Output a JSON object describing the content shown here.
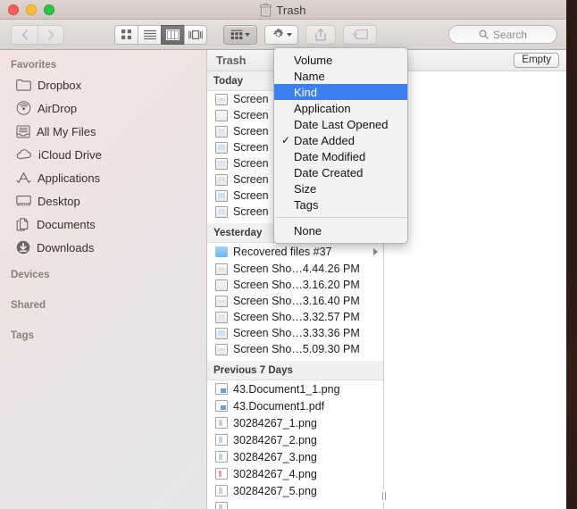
{
  "window": {
    "title": "Trash",
    "title_icon": "trash-icon",
    "traffic_lights": [
      "close",
      "minimize",
      "zoom"
    ]
  },
  "toolbar": {
    "back_icon": "chevron-left-icon",
    "forward_icon": "chevron-right-icon",
    "views": [
      {
        "name": "icon-view",
        "icon": "grid-icon",
        "active": false
      },
      {
        "name": "list-view",
        "icon": "list-icon",
        "active": false
      },
      {
        "name": "column-view",
        "icon": "columns-icon",
        "active": true
      },
      {
        "name": "coverflow-view",
        "icon": "coverflow-icon",
        "active": false
      }
    ],
    "arrange_icon": "arrange-grid-icon",
    "gear_icon": "gear-icon",
    "share_icon": "share-icon",
    "tag_icon": "tag-icon"
  },
  "search": {
    "placeholder": "Search",
    "value": "",
    "icon": "search-icon"
  },
  "sidebar": {
    "sections": [
      {
        "header": "Favorites",
        "items": [
          {
            "label": "Dropbox",
            "icon": "folder-icon"
          },
          {
            "label": "AirDrop",
            "icon": "airdrop-icon"
          },
          {
            "label": "All My Files",
            "icon": "all-my-files-icon"
          },
          {
            "label": "iCloud Drive",
            "icon": "cloud-icon"
          },
          {
            "label": "Applications",
            "icon": "applications-icon"
          },
          {
            "label": "Desktop",
            "icon": "desktop-icon"
          },
          {
            "label": "Documents",
            "icon": "documents-icon"
          },
          {
            "label": "Downloads",
            "icon": "downloads-icon"
          }
        ]
      },
      {
        "header": "Devices",
        "items": []
      },
      {
        "header": "Shared",
        "items": []
      },
      {
        "header": "Tags",
        "items": []
      }
    ]
  },
  "column1": {
    "header": "Trash",
    "groups": [
      {
        "label": "Today",
        "rows": [
          {
            "name": "Screen",
            "icon": "screenshot-icon",
            "variant": "v1"
          },
          {
            "name": "Screen",
            "icon": "screenshot-icon",
            "variant": "v2"
          },
          {
            "name": "Screen",
            "icon": "screenshot-icon",
            "variant": "v3"
          },
          {
            "name": "Screen",
            "icon": "screenshot-icon",
            "variant": "v4"
          },
          {
            "name": "Screen",
            "icon": "screenshot-icon",
            "variant": "v5"
          },
          {
            "name": "Screen",
            "icon": "screenshot-icon",
            "variant": "v3"
          },
          {
            "name": "Screen",
            "icon": "screenshot-icon",
            "variant": "v4"
          },
          {
            "name": "Screen",
            "icon": "screenshot-icon",
            "variant": "v5"
          }
        ]
      },
      {
        "label": "Yesterday",
        "rows": [
          {
            "name": "Recovered files #37",
            "icon": "folder-icon",
            "has_disclosure": true
          },
          {
            "name": "Screen Sho…4.44.26 PM",
            "icon": "screenshot-icon",
            "variant": "v1"
          },
          {
            "name": "Screen Sho…3.16.20 PM",
            "icon": "screenshot-icon",
            "variant": "v2"
          },
          {
            "name": "Screen Sho…3.16.40 PM",
            "icon": "screenshot-icon",
            "variant": "v1"
          },
          {
            "name": "Screen Sho…3.32.57 PM",
            "icon": "screenshot-icon",
            "variant": "v3"
          },
          {
            "name": "Screen Sho…3.33.36 PM",
            "icon": "screenshot-icon",
            "variant": "v4"
          },
          {
            "name": "Screen Sho…5.09.30 PM",
            "icon": "screenshot-icon",
            "variant": "v1"
          }
        ]
      },
      {
        "label": "Previous 7 Days",
        "rows": [
          {
            "name": "43.Document1_1.png",
            "icon": "image-file-icon",
            "variant": "doc"
          },
          {
            "name": "43.Document1.pdf",
            "icon": "pdf-file-icon",
            "variant": "doc"
          },
          {
            "name": "30284267_1.png",
            "icon": "image-file-icon",
            "variant": "img"
          },
          {
            "name": "30284267_2.png",
            "icon": "image-file-icon",
            "variant": "img"
          },
          {
            "name": "30284267_3.png",
            "icon": "image-file-icon",
            "variant": "img"
          },
          {
            "name": "30284267_4.png",
            "icon": "image-file-icon",
            "variant": "imgr"
          },
          {
            "name": "30284267_5.png",
            "icon": "image-file-icon",
            "variant": "img"
          }
        ]
      }
    ]
  },
  "column2": {
    "empty_button": "Empty",
    "resize_handle_icon": "column-resize-icon"
  },
  "menu": {
    "name": "arrange-by-menu",
    "items": [
      {
        "label": "Volume",
        "checked": false,
        "selected": false
      },
      {
        "label": "Name",
        "checked": false,
        "selected": false
      },
      {
        "label": "Kind",
        "checked": false,
        "selected": true
      },
      {
        "label": "Application",
        "checked": false,
        "selected": false
      },
      {
        "label": "Date Last Opened",
        "checked": false,
        "selected": false
      },
      {
        "label": "Date Added",
        "checked": true,
        "selected": false
      },
      {
        "label": "Date Modified",
        "checked": false,
        "selected": false
      },
      {
        "label": "Date Created",
        "checked": false,
        "selected": false
      },
      {
        "label": "Size",
        "checked": false,
        "selected": false
      },
      {
        "label": "Tags",
        "checked": false,
        "selected": false
      },
      {
        "separator": true
      },
      {
        "label": "None",
        "checked": false,
        "selected": false
      }
    ],
    "checkmark": "✓",
    "highlight_color": "#3b7ff2"
  }
}
